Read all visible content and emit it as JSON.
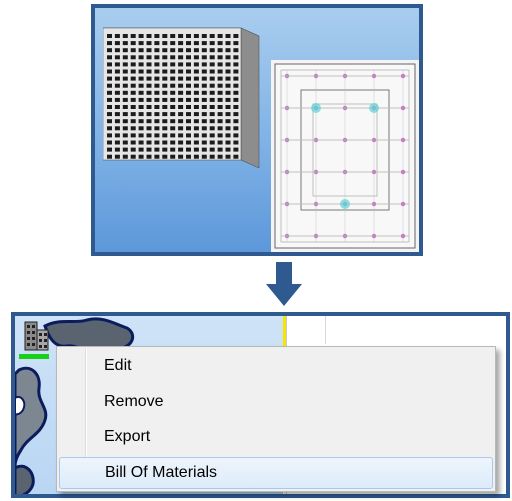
{
  "context_menu": {
    "items": [
      {
        "label": "Edit"
      },
      {
        "label": "Remove"
      },
      {
        "label": "Export"
      },
      {
        "label": "Bill Of Materials",
        "highlighted": true
      }
    ]
  },
  "icons": {
    "arrow": "arrow-down-icon",
    "building": "building-icon",
    "tree_item": "building-tree-icon"
  },
  "colors": {
    "frame": "#2e5a8f",
    "arrow": "#2e5a8f",
    "tree_pane": "#cfe3f7",
    "menu_bg": "#f0f0f0",
    "menu_highlight": "#dcebfa",
    "selection": "#19d019",
    "marker_line": "#f4e600"
  }
}
